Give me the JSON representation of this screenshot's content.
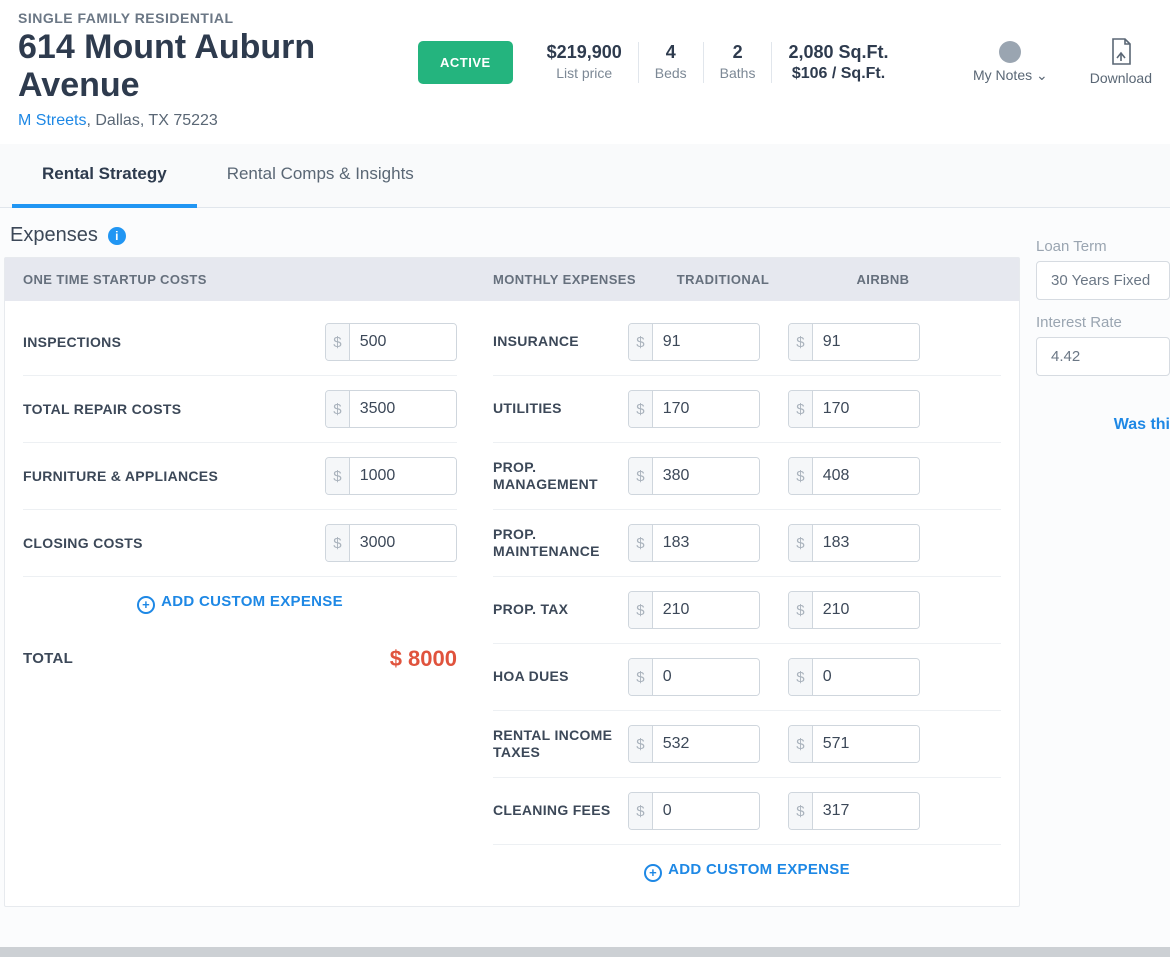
{
  "header": {
    "property_type": "SINGLE FAMILY RESIDENTIAL",
    "address": "614 Mount Auburn Avenue",
    "neighborhood": "M Streets",
    "city_line": ", Dallas, TX 75223",
    "status_badge": "ACTIVE",
    "stats": {
      "list_price": {
        "value": "$219,900",
        "label": "List price"
      },
      "beds": {
        "value": "4",
        "label": "Beds"
      },
      "baths": {
        "value": "2",
        "label": "Baths"
      },
      "sqft": {
        "value": "2,080 Sq.Ft.",
        "value2": "$106 / Sq.Ft."
      }
    },
    "actions": {
      "notes": "My Notes",
      "download": "Download"
    }
  },
  "tabs": {
    "t1": "Rental Strategy",
    "t2": "Rental Comps & Insights"
  },
  "expenses": {
    "title": "Expenses",
    "headers": {
      "startup": "ONE TIME STARTUP COSTS",
      "monthly": "MONTHLY EXPENSES",
      "traditional": "TRADITIONAL",
      "airbnb": "AIRBNB"
    },
    "startup": {
      "inspections": {
        "label": "INSPECTIONS",
        "value": "500"
      },
      "repair": {
        "label": "TOTAL REPAIR COSTS",
        "value": "3500"
      },
      "furniture": {
        "label": "FURNITURE & APPLIANCES",
        "value": "1000"
      },
      "closing": {
        "label": "CLOSING COSTS",
        "value": "3000"
      },
      "add": "ADD CUSTOM EXPENSE",
      "total_label": "TOTAL",
      "total_value": "$ 8000"
    },
    "monthly": {
      "insurance": {
        "label": "INSURANCE",
        "trad": "91",
        "airbnb": "91"
      },
      "utilities": {
        "label": "UTILITIES",
        "trad": "170",
        "airbnb": "170"
      },
      "mgmt": {
        "label": "PROP. MANAGEMENT",
        "trad": "380",
        "airbnb": "408"
      },
      "maint": {
        "label": "PROP. MAINTENANCE",
        "trad": "183",
        "airbnb": "183"
      },
      "tax": {
        "label": "PROP. TAX",
        "trad": "210",
        "airbnb": "210"
      },
      "hoa": {
        "label": "HOA DUES",
        "trad": "0",
        "airbnb": "0"
      },
      "income_tax": {
        "label": "RENTAL INCOME TAXES",
        "trad": "532",
        "airbnb": "571"
      },
      "cleaning": {
        "label": "CLEANING FEES",
        "trad": "0",
        "airbnb": "317"
      },
      "add": "ADD CUSTOM EXPENSE"
    }
  },
  "sidebar": {
    "loan_term_label": "Loan Term",
    "loan_term_value": "30 Years Fixed",
    "interest_label": "Interest Rate",
    "interest_value": "4.42",
    "was_link": "Was thi"
  }
}
